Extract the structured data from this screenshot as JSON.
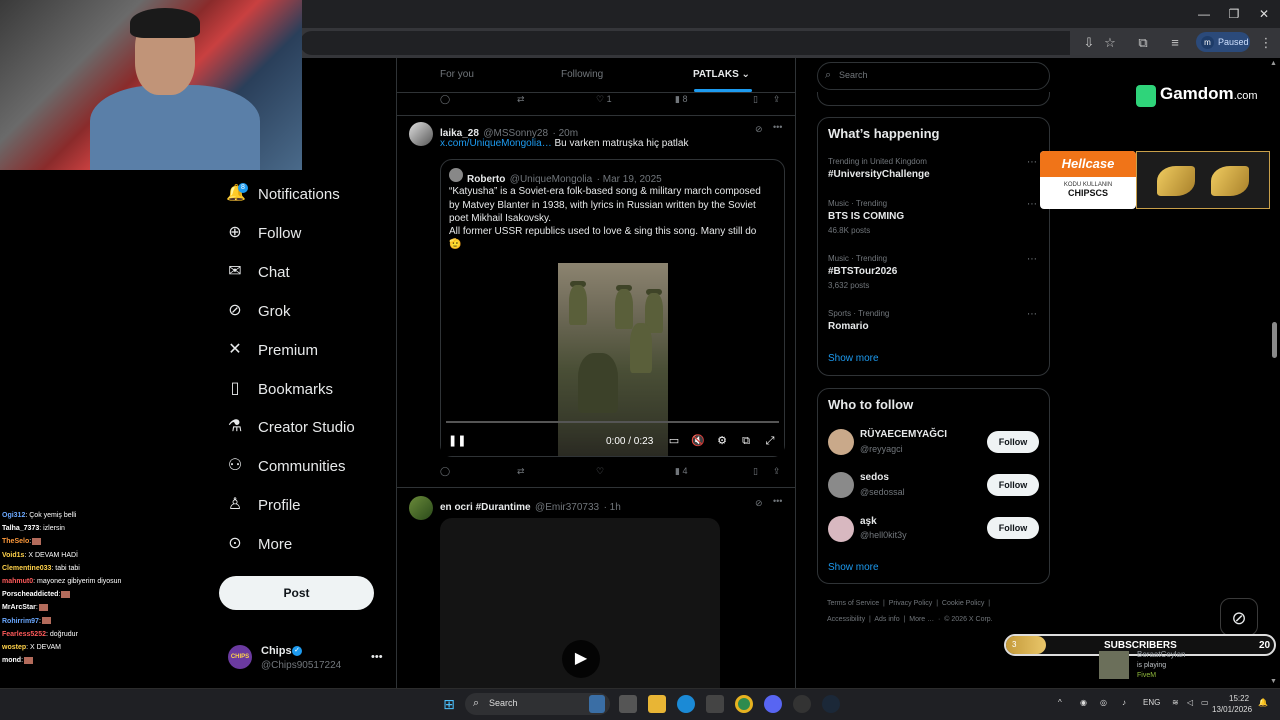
{
  "browser": {
    "paused_label": "Paused",
    "profile_initial": "m"
  },
  "nav": {
    "items": [
      {
        "label": "Notifications",
        "icon": "bell-icon",
        "glyph": "🔔"
      },
      {
        "label": "Follow",
        "icon": "person-plus-icon",
        "glyph": "👤"
      },
      {
        "label": "Chat",
        "icon": "mail-icon",
        "glyph": "✉"
      },
      {
        "label": "Grok",
        "icon": "grok-icon",
        "glyph": "⊘"
      },
      {
        "label": "Premium",
        "icon": "x-logo-icon",
        "glyph": "𝕏"
      },
      {
        "label": "Bookmarks",
        "icon": "bookmark-icon",
        "glyph": "🔖"
      },
      {
        "label": "Creator Studio",
        "icon": "flask-icon",
        "glyph": "⚗"
      },
      {
        "label": "Communities",
        "icon": "people-icon",
        "glyph": "👥"
      },
      {
        "label": "Profile",
        "icon": "person-icon",
        "glyph": "👤"
      },
      {
        "label": "More",
        "icon": "more-circle-icon",
        "glyph": "⋯"
      }
    ],
    "notifications_badge": "8",
    "post_label": "Post"
  },
  "account": {
    "name": "Chips",
    "handle": "@Chips90517224",
    "avatar_text": "CHIPS"
  },
  "chat": [
    {
      "user": "Ogi312",
      "color": "#6aa8ff",
      "msg": ": Çok yemiş belli"
    },
    {
      "user": "Talha_7373",
      "color": "#ffffff",
      "msg": ": izlersin"
    },
    {
      "user": "TheSelo",
      "color": "#ff9a3c",
      "msg": ":"
    },
    {
      "user": "Void1s",
      "color": "#ffd24a",
      "msg": ": X DEVAM HADİ"
    },
    {
      "user": "Clementine033",
      "color": "#ffd24a",
      "msg": ": tabi tabi"
    },
    {
      "user": "mahmut0",
      "color": "#ff5a5a",
      "msg": ": mayonez gibiyerim diyosun"
    },
    {
      "user": "Porscheaddicted",
      "color": "#ffffff",
      "msg": ":"
    },
    {
      "user": "MrArcStar",
      "color": "#ffffff",
      "msg": ":"
    },
    {
      "user": "Rohirrim97",
      "color": "#6aa8ff",
      "msg": ":"
    },
    {
      "user": "Fearless5252",
      "color": "#ff5a5a",
      "msg": ": doğrudur"
    },
    {
      "user": "wostep",
      "color": "#ffd24a",
      "msg": ": X DEVAM"
    },
    {
      "user": "mond",
      "color": "#ffffff",
      "msg": ":"
    }
  ],
  "tabs": [
    {
      "label": "For you"
    },
    {
      "label": "Following"
    },
    {
      "label": "PATLAKS"
    }
  ],
  "prev_tweet": {
    "likes": "1",
    "views": "8"
  },
  "tweet": {
    "name": "laika_28",
    "handle": "@MSSonny28",
    "time": "· 20m",
    "link": "x.com/UniqueMongolia…",
    "text": " Bu varken matruşka hiç patlak",
    "quote": {
      "name": "Roberto",
      "handle": "@UniqueMongolia",
      "date": "· Mar 19, 2025",
      "line1": "“Katyusha” is a Soviet-era folk-based song & military march composed",
      "line2": "by Matvey Blanter in 1938, with lyrics in Russian written by the Soviet",
      "line3": "poet Mikhail Isakovsky.",
      "line4": "All former USSR republics used to love & sing this song. Many still do",
      "emoji": "🫡"
    },
    "video_time": "0:00 / 0:23",
    "views": "4"
  },
  "tweet2": {
    "name": "en ocri #Durantime",
    "handle": "@Emir370733",
    "time": "· 1h"
  },
  "search": {
    "placeholder": "Search"
  },
  "trends": {
    "heading": "What’s happening",
    "items": [
      {
        "category": "Trending in United Kingdom",
        "title": "#UniversityChallenge",
        "posts": ""
      },
      {
        "category": "Music · Trending",
        "title": "BTS IS COMING",
        "posts": "46.8K posts"
      },
      {
        "category": "Music · Trending",
        "title": "#BTSTour2026",
        "posts": "3,632 posts"
      },
      {
        "category": "Sports · Trending",
        "title": "Romario",
        "posts": ""
      }
    ],
    "show_more": "Show more"
  },
  "who_to_follow": {
    "heading": "Who to follow",
    "users": [
      {
        "name": "RÜYAECEMYAĞCI",
        "handle": "@reyyagci",
        "avatar_color": "#c9a98a"
      },
      {
        "name": "sedos",
        "handle": "@sedossal",
        "avatar_color": "#8a8a8a"
      },
      {
        "name": "aşk",
        "handle": "@hell0kit3y",
        "avatar_color": "#d8b8c0"
      }
    ],
    "follow_label": "Follow",
    "show_more": "Show more"
  },
  "footer": {
    "links": [
      "Terms of Service",
      "Privacy Policy",
      "Cookie Policy",
      "Accessibility",
      "Ads info",
      "More …",
      "© 2026 X Corp."
    ]
  },
  "overlays": {
    "gamdom_main": "Gamdom",
    "gamdom_tld": ".com",
    "hellcase_brand": "Hellcase",
    "hellcase_sub": "KODU KULLANIN",
    "hellcase_code": "CHIPSCS",
    "subs_label": "SUBSCRIBERS",
    "subs_current": "3",
    "subs_goal": "20",
    "subs_progress_fraction": 0.15,
    "steam_user": "BeraatCeylan",
    "steam_status": "is playing",
    "steam_game": "FiveM"
  },
  "taskbar": {
    "search_label": "Search",
    "lang": "ENG",
    "time": "15:22",
    "date": "13/01/2026"
  },
  "colors": {
    "accent": "#1d9bf0",
    "background": "#000000",
    "border": "#2f3336",
    "muted": "#71767b"
  }
}
